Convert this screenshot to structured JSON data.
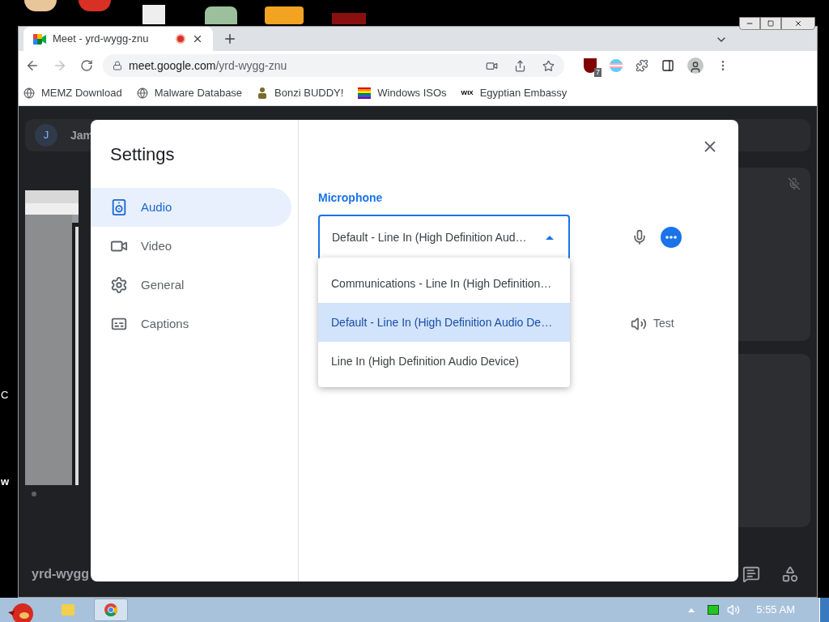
{
  "desktop": {
    "labels": [
      "C",
      "w"
    ]
  },
  "browser": {
    "tabs": [
      {
        "title": "Meet - yrd-wygg-znu",
        "selected": true,
        "recording": true
      }
    ],
    "address": {
      "host": "meet.google.com",
      "path": "/yrd-wygg-znu"
    },
    "extension_badge": "7",
    "bookmarks": [
      {
        "label": "MEMZ Download",
        "kind": "globe"
      },
      {
        "label": "Malware Database",
        "kind": "globe"
      },
      {
        "label": "Bonzi BUDDY!",
        "kind": "figure"
      },
      {
        "label": "Windows ISOs",
        "kind": "rainbow"
      },
      {
        "label": "Egyptian Embassy",
        "kind": "logo",
        "logo_text": "WIX"
      }
    ]
  },
  "meet": {
    "participant": {
      "initial": "J",
      "name": "Jam"
    },
    "meeting_code": "yrd-wygg"
  },
  "settings": {
    "title": "Settings",
    "nav": [
      {
        "label": "Audio",
        "kind": "speaker",
        "selected": true
      },
      {
        "label": "Video",
        "kind": "camera",
        "selected": false
      },
      {
        "label": "General",
        "kind": "gear",
        "selected": false
      },
      {
        "label": "Captions",
        "kind": "captions",
        "selected": false
      }
    ],
    "microphone": {
      "label": "Microphone",
      "value": "Default - Line In (High Definition Aud…",
      "expanded": true,
      "options": [
        {
          "label": "Communications - Line In (High Definition…",
          "selected": false
        },
        {
          "label": "Default - Line In (High Definition Audio De…",
          "selected": true
        },
        {
          "label": "Line In (High Definition Audio Device)",
          "selected": false
        }
      ]
    },
    "speaker_test": "Test"
  },
  "taskbar": {
    "time": "5:55 AM"
  }
}
